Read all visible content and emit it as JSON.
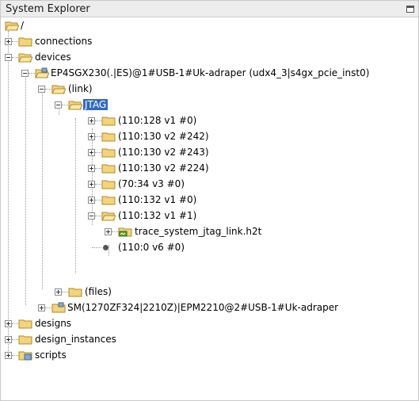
{
  "window": {
    "title": "System Explorer"
  },
  "tree": {
    "root": "/",
    "connections": "connections",
    "devices": "devices",
    "device1": "EP4SGX230(.|ES)@1#USB-1#Uk-adraper (udx4_3|s4gx_pcie_inst0)",
    "link": "(link)",
    "jtag": "JTAG",
    "nodes": [
      "(110:128 v1 #0)",
      "(110:130 v2 #242)",
      "(110:130 v2 #243)",
      "(110:130 v2 #224)",
      "(70:34 v3 #0)",
      "(110:132 v1 #0)",
      "(110:132 v1 #1)"
    ],
    "trace_file": "trace_system_jtag_link.h2t",
    "leaf_node": "(110:0 v6 #0)",
    "files": "(files)",
    "device2": "SM(1270ZF324|2210Z)|EPM2210@2#USB-1#Uk-adraper",
    "designs": "designs",
    "design_instances": "design_instances",
    "scripts": "scripts"
  }
}
